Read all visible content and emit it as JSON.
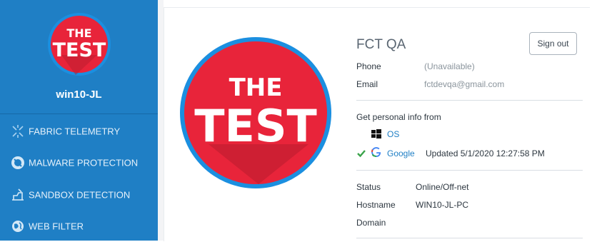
{
  "sidebar": {
    "logo": {
      "line1": "THE",
      "line2": "TEST"
    },
    "device_name": "win10-JL",
    "items": [
      {
        "label": "FABRIC TELEMETRY",
        "icon": "fabric-telemetry-icon"
      },
      {
        "label": "MALWARE PROTECTION",
        "icon": "malware-protection-icon"
      },
      {
        "label": "SANDBOX DETECTION",
        "icon": "sandbox-detection-icon"
      },
      {
        "label": "WEB FILTER",
        "icon": "web-filter-icon"
      }
    ]
  },
  "profile": {
    "avatar": {
      "line1": "THE",
      "line2": "TEST"
    },
    "name": "FCT QA",
    "signout_label": "Sign out",
    "phone_label": "Phone",
    "phone_value": "(Unavailable)",
    "email_label": "Email",
    "email_value": "fctdevqa@gmail.com",
    "personal_info_label": "Get personal info from",
    "sources": [
      {
        "label": "OS",
        "icon": "windows-icon",
        "checked": false,
        "updated": ""
      },
      {
        "label": "Google",
        "icon": "google-icon",
        "checked": true,
        "updated": "Updated 5/1/2020 12:27:58 PM"
      }
    ],
    "status_label": "Status",
    "status_value": "Online/Off-net",
    "hostname_label": "Hostname",
    "hostname_value": "WIN10-JL-PC",
    "domain_label": "Domain",
    "domain_value": ""
  },
  "colors": {
    "sidebar_bg": "#1f7fc5",
    "logo_red": "#e8243a",
    "logo_ring": "#1b8fe0",
    "link_blue": "#1f7fc5",
    "check_green": "#3aa34a"
  }
}
